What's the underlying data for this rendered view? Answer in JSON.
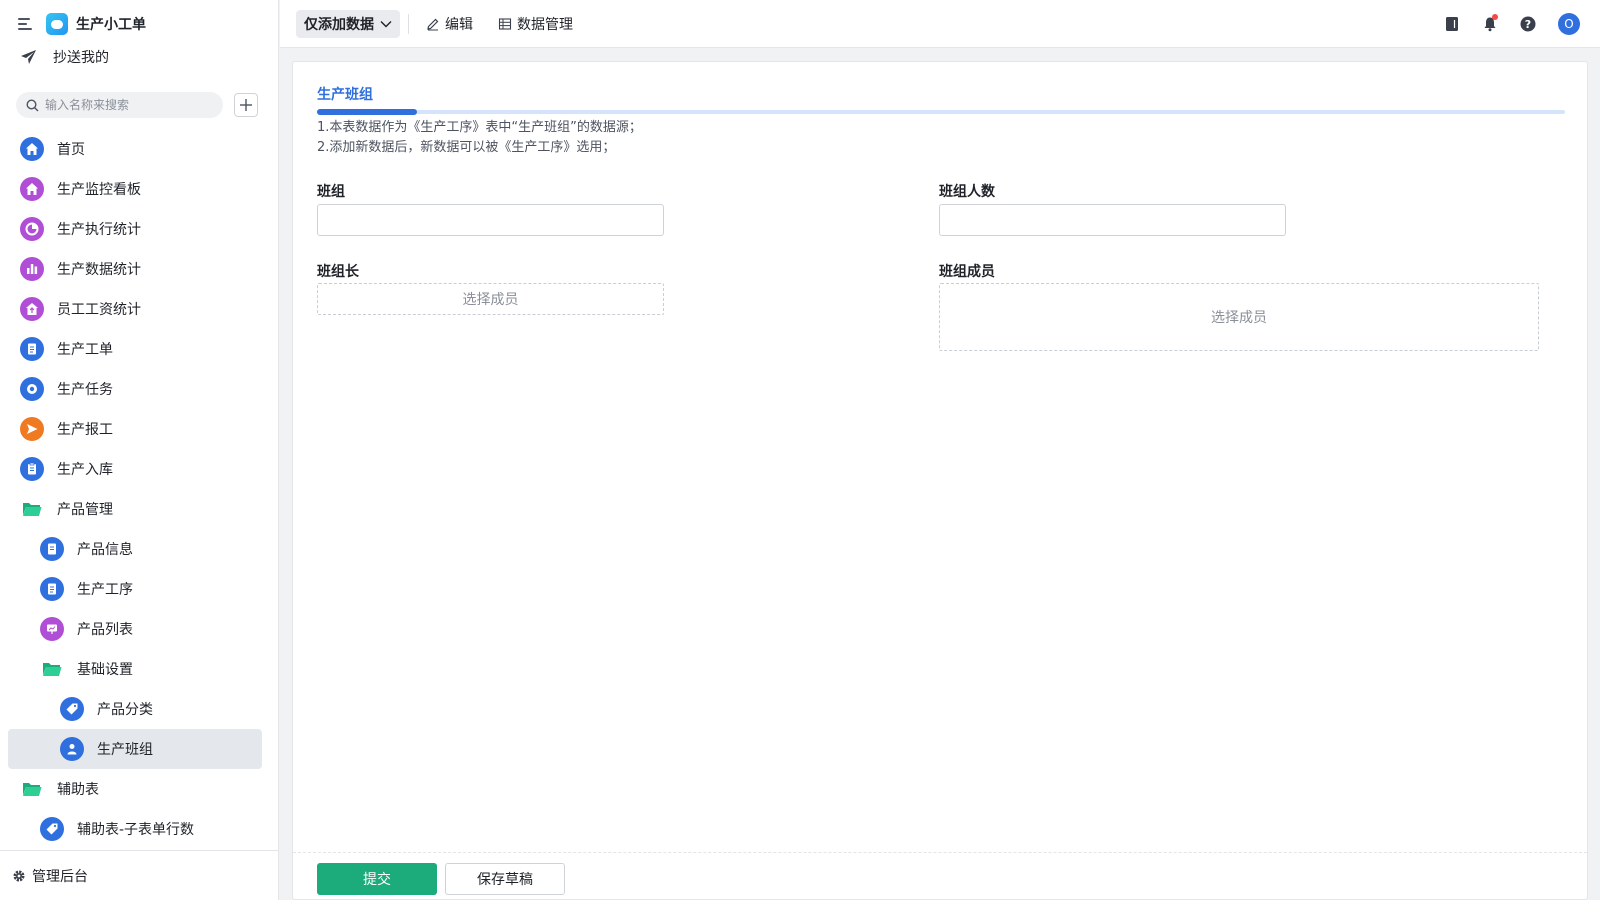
{
  "app": {
    "title": "生产小工单"
  },
  "cc": {
    "label": "抄送我的"
  },
  "search": {
    "placeholder": "输入名称来搜索"
  },
  "nav": [
    {
      "label": "首页",
      "icon": "home-icon",
      "color": "#2f6fde"
    },
    {
      "label": "生产监控看板",
      "icon": "home-icon",
      "color": "#b04fd6"
    },
    {
      "label": "生产执行统计",
      "icon": "pie-chart-icon",
      "color": "#b04fd6"
    },
    {
      "label": "生产数据统计",
      "icon": "bar-chart-icon",
      "color": "#b04fd6"
    },
    {
      "label": "员工工资统计",
      "icon": "home-icon",
      "color": "#b04fd6"
    },
    {
      "label": "生产工单",
      "icon": "document-icon",
      "color": "#2f6fde"
    },
    {
      "label": "生产任务",
      "icon": "target-icon",
      "color": "#2f6fde"
    },
    {
      "label": "生产报工",
      "icon": "send-icon",
      "color": "#f07a22"
    },
    {
      "label": "生产入库",
      "icon": "clipboard-icon",
      "color": "#2f6fde"
    },
    {
      "label": "产品管理",
      "icon": "folder-icon",
      "color": "#1cab7a"
    },
    {
      "label": "产品信息",
      "icon": "document-icon",
      "color": "#2f6fde"
    },
    {
      "label": "生产工序",
      "icon": "document-icon",
      "color": "#2f6fde"
    },
    {
      "label": "产品列表",
      "icon": "presentation-icon",
      "color": "#b04fd6"
    },
    {
      "label": "基础设置",
      "icon": "folder-icon",
      "color": "#1cab7a"
    },
    {
      "label": "产品分类",
      "icon": "tag-icon",
      "color": "#2f6fde"
    },
    {
      "label": "生产班组",
      "icon": "user-icon",
      "color": "#2f6fde"
    },
    {
      "label": "辅助表",
      "icon": "folder-icon",
      "color": "#1cab7a"
    },
    {
      "label": "辅助表-子表单行数",
      "icon": "tag-icon",
      "color": "#2f6fde"
    }
  ],
  "footer": {
    "admin_label": "管理后台"
  },
  "topbar": {
    "mode": "仅添加数据",
    "edit": "编辑",
    "data_manage": "数据管理",
    "avatar": "O"
  },
  "form": {
    "tab": "生产班组",
    "desc1": "1.本表数据作为《生产工序》表中“生产班组”的数据源；",
    "desc2": "2.添加新数据后，新数据可以被《生产工序》选用；",
    "fields": {
      "team": {
        "label": "班组",
        "value": ""
      },
      "team_count": {
        "label": "班组人数",
        "value": ""
      },
      "leader": {
        "label": "班组长",
        "placeholder": "选择成员"
      },
      "members": {
        "label": "班组成员",
        "placeholder": "选择成员"
      }
    },
    "submit": "提交",
    "save_draft": "保存草稿"
  },
  "colors": {
    "accent": "#2f6fde",
    "submit": "#1cab7a",
    "purple": "#b04fd6",
    "orange": "#f07a22",
    "folder": "#1cab7a"
  }
}
